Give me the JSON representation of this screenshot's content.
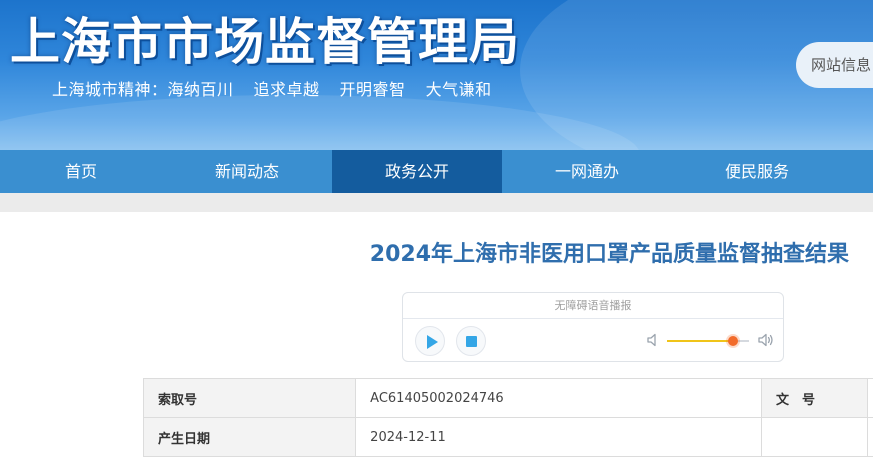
{
  "header": {
    "site_title": "上海市市场监督管理局",
    "slogan": {
      "prefix": "上海城市精神：",
      "items": [
        "海纳百川",
        "追求卓越",
        "开明睿智",
        "大气谦和"
      ]
    },
    "site_info_label": "网站信息"
  },
  "nav": {
    "items": [
      {
        "label": "首页"
      },
      {
        "label": "新闻动态"
      },
      {
        "label": "政务公开"
      },
      {
        "label": "一网通办"
      },
      {
        "label": "便民服务"
      }
    ],
    "active_index": 2
  },
  "article": {
    "title": "2024年上海市非医用口罩产品质量监督抽查结果"
  },
  "audio_player": {
    "header_label": "无障碍语音播报",
    "volume_level": 0.8,
    "icons": [
      "play-icon",
      "stop-icon",
      "volume-low-icon",
      "volume-high-icon"
    ]
  },
  "meta_table": {
    "rows": [
      {
        "key": "索取号",
        "value": "AC61405002024746",
        "key2": "文　号",
        "value2": ""
      },
      {
        "key": "产生日期",
        "value": "2024-12-11",
        "key2": "",
        "value2": ""
      }
    ]
  },
  "colors": {
    "nav_bg": "#3a8fd0",
    "nav_active": "#145c9e",
    "title_blue": "#2f6ead",
    "player_accent": "#34a6e6",
    "volume_fill": "#f0c419",
    "volume_knob": "#f26b2a"
  }
}
